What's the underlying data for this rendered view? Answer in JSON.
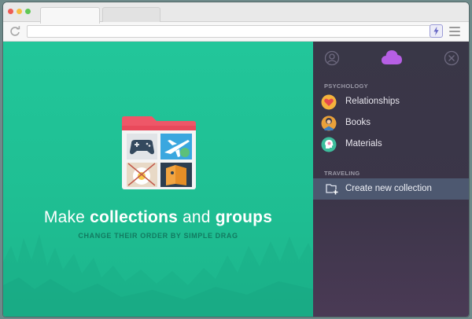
{
  "browser": {
    "address_value": "",
    "tabs": [
      {
        "label": "",
        "active": true
      },
      {
        "label": "",
        "active": false
      }
    ],
    "traffic_lights": [
      "#ee5c54",
      "#f5be41",
      "#5fc855"
    ]
  },
  "hero": {
    "headline_part1": "Make ",
    "headline_bold1": "collections",
    "headline_part2": " and ",
    "headline_bold2": "groups",
    "subline": "CHANGE THEIR ORDER BY SIMPLE DRAG"
  },
  "sidebar": {
    "sections": [
      {
        "title": "PSYCHOLOGY",
        "items": [
          {
            "label": "Relationships",
            "icon": "heart-icon",
            "color": "#f4b23c"
          },
          {
            "label": "Books",
            "icon": "reader-icon",
            "color": "#e9a13a"
          },
          {
            "label": "Materials",
            "icon": "head-icon",
            "color": "#3dbd9c"
          }
        ]
      },
      {
        "title": "TRAVELING",
        "items": []
      }
    ],
    "create_label": "Create new collection"
  },
  "colors": {
    "accent_green": "#22c69a",
    "sidebar_bg": "#393747",
    "cloud_purple": "#b65fe4",
    "highlight_row": "#4d5870"
  }
}
